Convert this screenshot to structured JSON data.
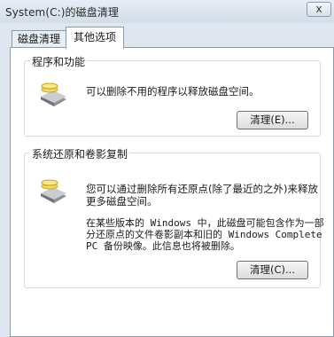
{
  "window": {
    "title": "System(C:)的磁盘清理",
    "close_glyph": "x"
  },
  "tabs": [
    {
      "label": "磁盘清理",
      "selected": false
    },
    {
      "label": "其他选项",
      "selected": true
    }
  ],
  "programs_group": {
    "title": "程序和功能",
    "description": "可以删除不用的程序以释放磁盘空间。",
    "button_label": "清理(E)...",
    "icon": "disk-cleanup-icon"
  },
  "restore_group": {
    "title": "系统还原和卷影复制",
    "description": "您可以通过删除所有还原点(除了最近的之外)来释放更多磁盘空间。",
    "note": "在某些版本的 Windows 中，此磁盘可能包含作为一部分还原点的文件卷影副本和旧的 Windows Complete PC 备份映像。此信息也将被删除。",
    "button_label": "清理(C)...",
    "icon": "disk-cleanup-icon"
  }
}
